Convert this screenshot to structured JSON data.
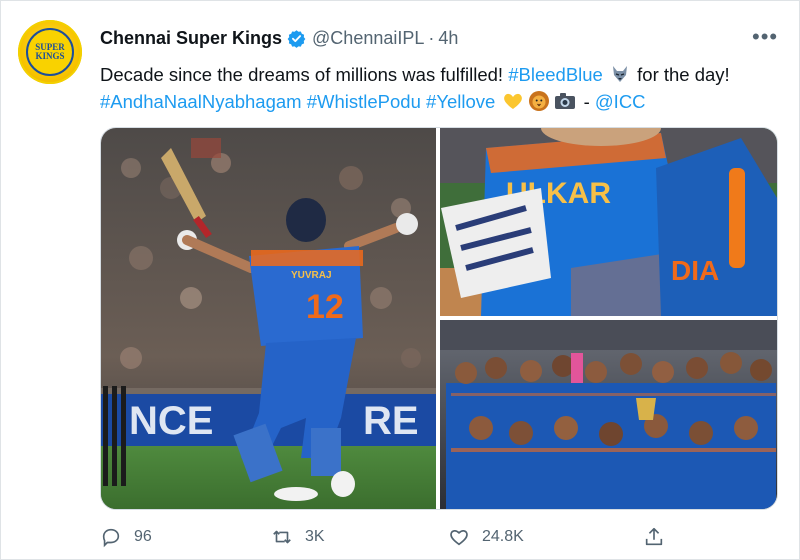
{
  "tweet": {
    "display_name": "Chennai Super Kings",
    "handle": "@ChennaiIPL",
    "separator": "·",
    "time": "4h",
    "avatar_text": [
      "SUPER",
      "KINGS"
    ],
    "text_line1": {
      "plain": "Decade since the dreams of millions was fulfilled! ",
      "tag1": "#BleedBlue",
      "after": " for the day!"
    },
    "text_line2": {
      "tag1": "#AndhaNaalNyabhagam",
      "tag2": "#WhistlePodu",
      "tag3": "#Yellove",
      "dash": " - ",
      "mention": "@ICC"
    },
    "media": {
      "left_board_text": "NCE",
      "left_board_text2": "RE",
      "jersey_name": "YUVRAJ",
      "jersey_number": "12",
      "top_right_text": "ULKAR",
      "top_right_text2": "DIA"
    },
    "actions": {
      "reply_count": "96",
      "retweet_count": "3K",
      "like_count": "24.8K"
    }
  },
  "colors": {
    "link": "#1d9bf0",
    "secondary": "#536471",
    "jersey_blue": "#1a72d6",
    "jersey_orange": "#f06a1a"
  }
}
